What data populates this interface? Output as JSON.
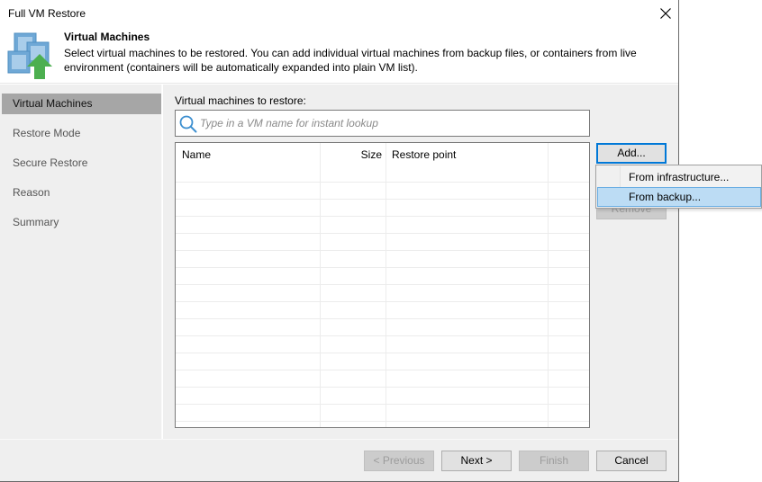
{
  "window": {
    "title": "Full VM Restore",
    "close_icon": "close-icon"
  },
  "header": {
    "icon": "vm-restore-icon",
    "title": "Virtual Machines",
    "description": "Select virtual machines to be restored. You can add individual virtual machines from backup files, or containers from live environment (containers will be automatically expanded into plain VM list)."
  },
  "sidebar": {
    "items": [
      {
        "label": "Virtual Machines",
        "active": true
      },
      {
        "label": "Restore Mode",
        "active": false
      },
      {
        "label": "Secure Restore",
        "active": false
      },
      {
        "label": "Reason",
        "active": false
      },
      {
        "label": "Summary",
        "active": false
      }
    ]
  },
  "main": {
    "vm_label": "Virtual machines to restore:",
    "search": {
      "icon": "search-icon",
      "placeholder": "Type in a VM name for instant lookup",
      "value": ""
    },
    "table": {
      "columns": [
        "Name",
        "Size",
        "Restore point"
      ],
      "rows": []
    },
    "buttons": {
      "add": "Add...",
      "remove": "Remove"
    }
  },
  "add_menu": {
    "items": [
      {
        "label": "From infrastructure...",
        "highlighted": false
      },
      {
        "label": "From backup...",
        "highlighted": true
      }
    ]
  },
  "footer": {
    "previous": "< Previous",
    "next": "Next >",
    "finish": "Finish",
    "cancel": "Cancel"
  },
  "colors": {
    "accent": "#0078d7",
    "menu_highlight": "#bcdcf4",
    "sidebar_active": "#a6a6a6",
    "panel_bg": "#efefef"
  }
}
